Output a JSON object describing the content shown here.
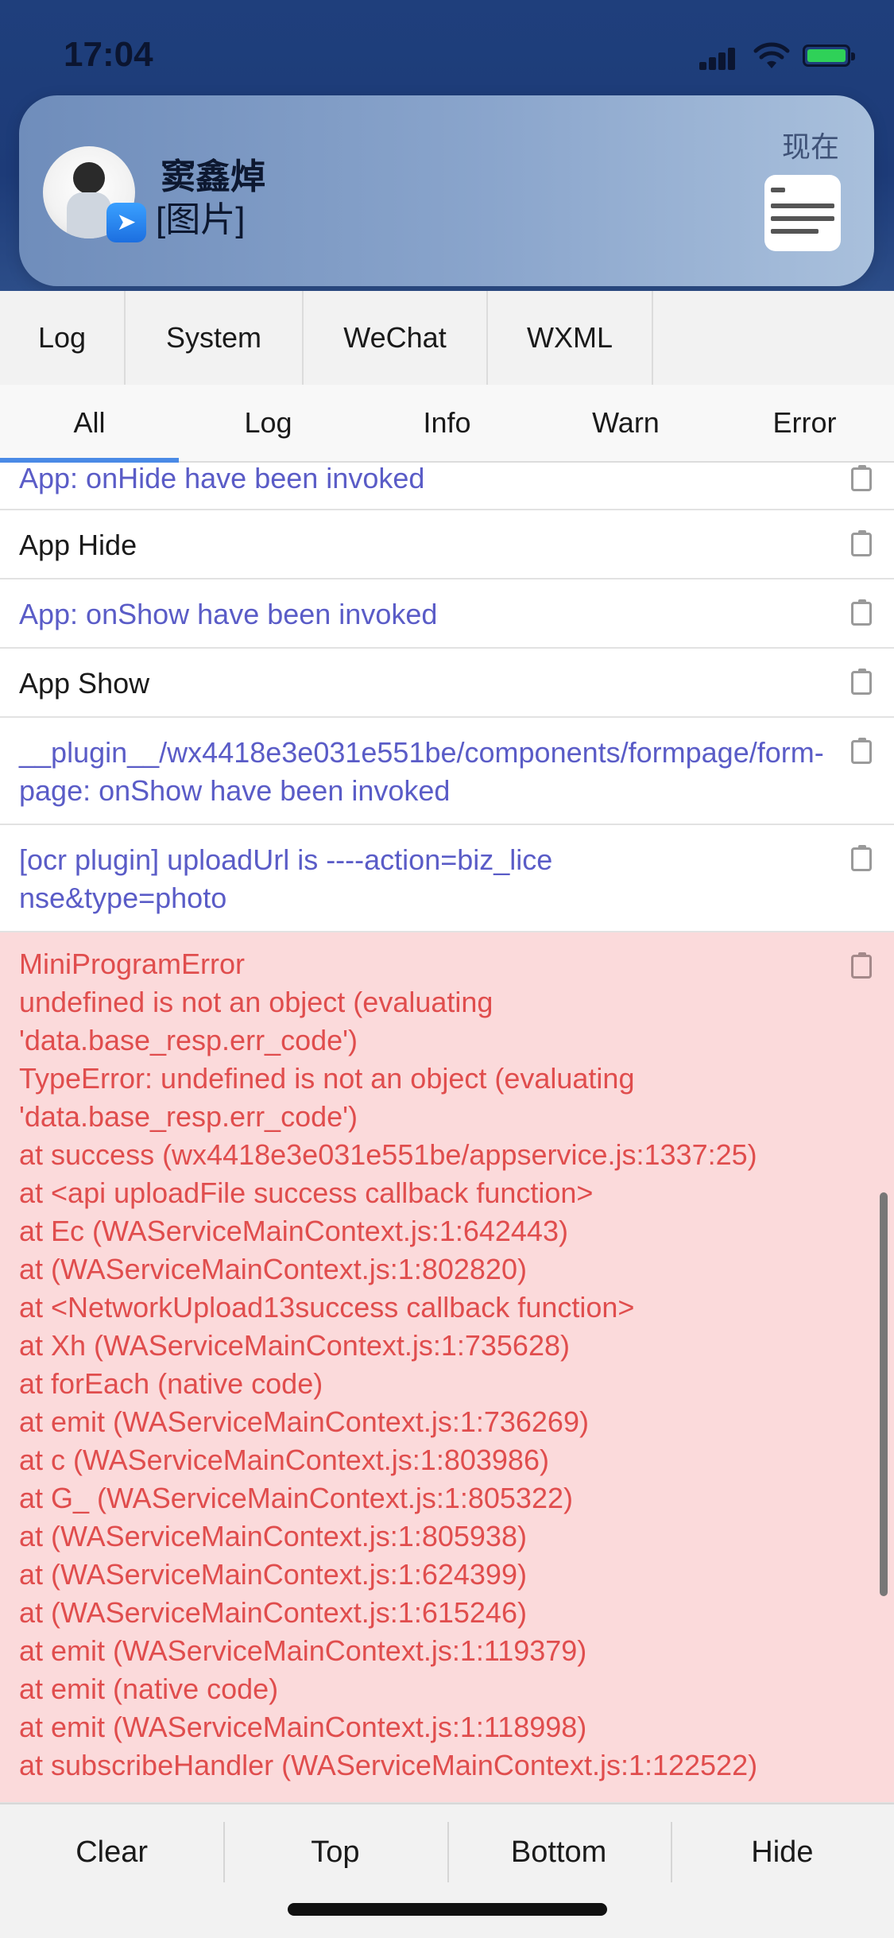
{
  "status_bar": {
    "time": "17:04"
  },
  "notification": {
    "sender": "窦鑫焯",
    "message": "[图片]",
    "time": "现在"
  },
  "tabs": [
    {
      "label": "Log"
    },
    {
      "label": "System"
    },
    {
      "label": "WeChat"
    },
    {
      "label": "WXML"
    }
  ],
  "filters": [
    {
      "label": "All",
      "active": true
    },
    {
      "label": "Log",
      "active": false
    },
    {
      "label": "Info",
      "active": false
    },
    {
      "label": "Warn",
      "active": false
    },
    {
      "label": "Error",
      "active": false
    }
  ],
  "logs": [
    {
      "level": "info",
      "text": "App: onHide have been invoked"
    },
    {
      "level": "log",
      "text": "App Hide"
    },
    {
      "level": "info",
      "text": "App: onShow have been invoked"
    },
    {
      "level": "log",
      "text": "App Show"
    },
    {
      "level": "info",
      "text": "__plugin__/wx4418e3e031e551be/components/formpage/form-page: onShow have been invoked"
    },
    {
      "level": "info",
      "text": "[ocr plugin] uploadUrl is ----action=biz_license&type=photo"
    }
  ],
  "error_log": {
    "lines": [
      "MiniProgramError",
      "undefined is not an object (evaluating",
      "'data.base_resp.err_code')",
      "TypeError: undefined is not an object (evaluating",
      "'data.base_resp.err_code')",
      "at success (wx4418e3e031e551be/appservice.js:1337:25)",
      "at <api uploadFile success callback function>",
      "at Ec (WAServiceMainContext.js:1:642443)",
      "at  (WAServiceMainContext.js:1:802820)",
      "at <NetworkUpload13success callback function>",
      "at Xh (WAServiceMainContext.js:1:735628)",
      "at forEach (native code)",
      "at emit (WAServiceMainContext.js:1:736269)",
      "at c (WAServiceMainContext.js:1:803986)",
      "at G_ (WAServiceMainContext.js:1:805322)",
      "at  (WAServiceMainContext.js:1:805938)",
      "at  (WAServiceMainContext.js:1:624399)",
      "at  (WAServiceMainContext.js:1:615246)",
      "at emit (WAServiceMainContext.js:1:119379)",
      "at emit (native code)",
      "at emit (WAServiceMainContext.js:1:118998)",
      "at subscribeHandler (WAServiceMainContext.js:1:122522)"
    ]
  },
  "bottom_bar": [
    {
      "label": "Clear"
    },
    {
      "label": "Top"
    },
    {
      "label": "Bottom"
    },
    {
      "label": "Hide"
    }
  ],
  "colors": {
    "info_text": "#5a5cc7",
    "error_text": "#e04d4d",
    "error_bg": "#fbdadb",
    "active_tab_underline": "#4a8ae6"
  }
}
